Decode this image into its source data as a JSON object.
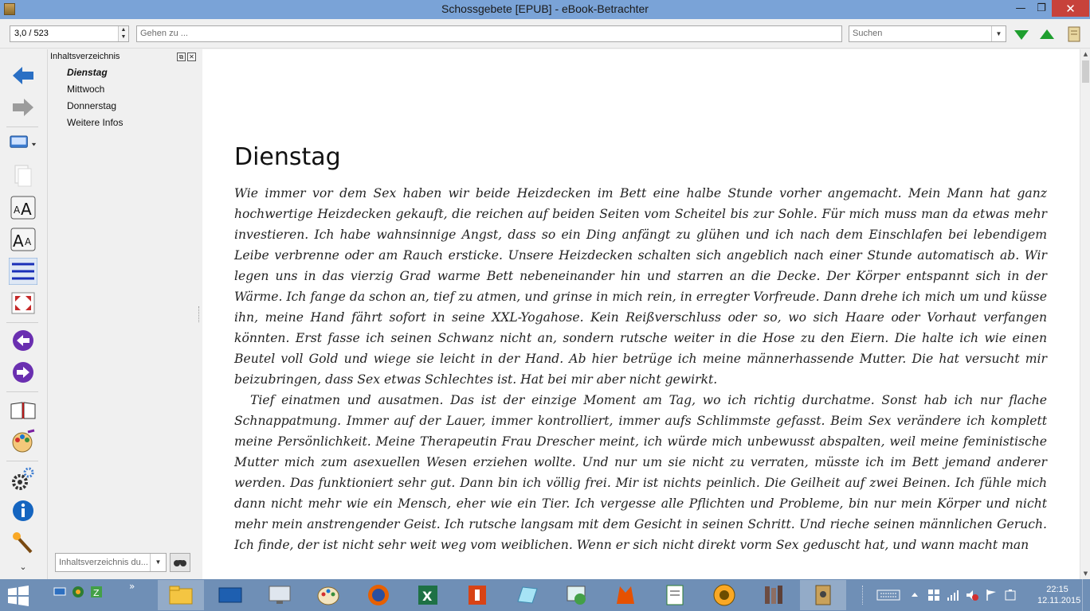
{
  "window": {
    "title": "Schossgebete [EPUB] - eBook-Betrachter",
    "min_glyph": "—",
    "max_glyph": "❐",
    "close_glyph": "✕"
  },
  "toolbar": {
    "page_value": "3,0 / 523",
    "goto_placeholder": "Gehen zu ...",
    "search_placeholder": "Suchen"
  },
  "toc": {
    "title": "Inhaltsverzeichnis",
    "items": [
      "Dienstag",
      "Mittwoch",
      "Donnerstag",
      "Weitere Infos"
    ],
    "active_index": 0,
    "filter_placeholder": "Inhaltsverzeichnis du..."
  },
  "content": {
    "chapter_title": "Dienstag",
    "paragraphs": [
      "Wie immer vor dem Sex haben wir beide Heizdecken im Bett eine halbe Stunde vorher angemacht. Mein Mann hat ganz hochwertige Heizdecken gekauft, die reichen auf beiden Seiten vom Scheitel bis zur Sohle. Für mich muss man da etwas mehr investieren. Ich habe wahnsinnige Angst, dass so ein Ding anfängt zu glühen und ich nach dem Einschlafen bei lebendigem Leibe verbrenne oder am Rauch ersticke. Unsere Heizdecken schalten sich angeblich nach einer Stunde automatisch ab. Wir legen uns in das vierzig Grad warme Bett nebeneinander hin und starren an die Decke. Der Körper entspannt sich in der Wärme. Ich fange da schon an, tief zu atmen, und grinse in mich rein, in erregter Vorfreude. Dann drehe ich mich um und küsse ihn, meine Hand fährt sofort in seine XXL-Yogahose. Kein Reißverschluss oder so, wo sich Haare oder Vorhaut verfangen könnten. Erst fasse ich seinen Schwanz nicht an, sondern rutsche weiter in die Hose zu den Eiern. Die halte ich wie einen Beutel voll Gold und wiege sie leicht in der Hand. Ab hier betrüge ich meine männerhassende Mutter. Die hat versucht mir beizubringen, dass Sex etwas Schlechtes ist. Hat bei mir aber nicht gewirkt.",
      "Tief einatmen und ausatmen. Das ist der einzige Moment am Tag, wo ich richtig durchatme. Sonst hab ich nur flache Schnappatmung. Immer auf der Lauer, immer kontrolliert, immer aufs Schlimmste gefasst. Beim Sex verändere ich komplett meine Persönlichkeit. Meine Therapeutin Frau Drescher meint, ich würde mich unbewusst abspalten, weil meine feministische Mutter mich zum asexuellen Wesen erziehen wollte. Und nur um sie nicht zu verraten, müsste ich im Bett jemand anderer werden. Das funktioniert sehr gut. Dann bin ich völlig frei. Mir ist nichts peinlich. Die Geilheit auf zwei Beinen. Ich fühle mich dann nicht mehr wie ein Mensch, eher wie ein Tier. Ich vergesse alle Pflichten und Probleme, bin nur mein Körper und nicht mehr mein anstrengender Geist. Ich rutsche langsam mit dem Gesicht in seinen Schritt. Und rieche seinen männlichen Geruch. Ich finde, der ist nicht sehr weit weg vom weiblichen. Wenn er sich nicht direkt vorm Sex geduscht hat, und wann macht man"
    ]
  },
  "taskbar": {
    "quick_chevron": "»",
    "clock_time": "22:15",
    "clock_date": "12.11.2015"
  },
  "colors": {
    "titlebar": "#7aa3d7",
    "close": "#c7423b",
    "taskbar": "#6f8fb6"
  }
}
